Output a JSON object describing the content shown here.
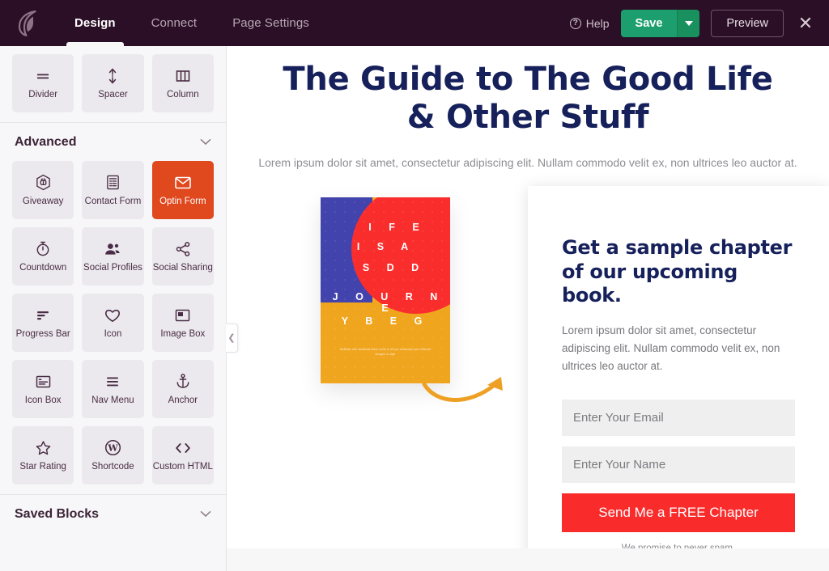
{
  "topbar": {
    "logo_icon": "seedprod-leaf-logo",
    "tabs": [
      {
        "label": "Design",
        "active": true
      },
      {
        "label": "Connect",
        "active": false
      },
      {
        "label": "Page Settings",
        "active": false
      }
    ],
    "help_label": "Help",
    "help_icon": "question-circle-icon",
    "save_label": "Save",
    "save_caret_icon": "chevron-down-icon",
    "preview_label": "Preview",
    "close_icon": "close-icon",
    "colors": {
      "bar_background": "#2b0f26",
      "save_green": "#1c9e6e",
      "active_tab_text": "#ffffff",
      "inactive_tab_text": "#b9a7b4"
    }
  },
  "sidebar": {
    "collapse_icon": "chevron-left-icon",
    "top_blocks": [
      {
        "label": "Divider",
        "icon": "divider-icon"
      },
      {
        "label": "Spacer",
        "icon": "spacer-arrows-icon"
      },
      {
        "label": "Column",
        "icon": "columns-icon"
      }
    ],
    "sections": [
      {
        "title": "Advanced",
        "chevron_icon": "chevron-down-icon",
        "blocks": [
          {
            "label": "Giveaway",
            "icon": "giveaway-icon",
            "selected": false
          },
          {
            "label": "Contact Form",
            "icon": "contact-form-icon",
            "selected": false
          },
          {
            "label": "Optin Form",
            "icon": "envelope-icon",
            "selected": true
          },
          {
            "label": "Countdown",
            "icon": "stopwatch-icon",
            "selected": false
          },
          {
            "label": "Social Profiles",
            "icon": "people-icon",
            "selected": false
          },
          {
            "label": "Social Sharing",
            "icon": "share-nodes-icon",
            "selected": false
          },
          {
            "label": "Progress Bar",
            "icon": "progress-bar-icon",
            "selected": false
          },
          {
            "label": "Icon",
            "icon": "heart-icon",
            "selected": false
          },
          {
            "label": "Image Box",
            "icon": "image-box-icon",
            "selected": false
          },
          {
            "label": "Icon Box",
            "icon": "icon-box-icon",
            "selected": false
          },
          {
            "label": "Nav Menu",
            "icon": "hamburger-icon",
            "selected": false
          },
          {
            "label": "Anchor",
            "icon": "anchor-icon",
            "selected": false
          },
          {
            "label": "Star Rating",
            "icon": "star-icon",
            "selected": false
          },
          {
            "label": "Shortcode",
            "icon": "wordpress-icon",
            "selected": false
          },
          {
            "label": "Custom HTML",
            "icon": "code-brackets-icon",
            "selected": false
          }
        ]
      },
      {
        "title": "Saved Blocks",
        "chevron_icon": "chevron-down-icon",
        "blocks": []
      }
    ],
    "colors": {
      "panel_background": "#f7f7f9",
      "tile_background": "#ebe9ee",
      "tile_selected": "#e0481e",
      "tile_text": "#4a2c44"
    }
  },
  "canvas": {
    "hero": {
      "heading_line1": "The Guide to The Good Life",
      "heading_line2": "& Other Stuff",
      "subtext": "Lorem ipsum dolor sit amet, consectetur adipiscing elit. Nullam commodo velit ex, non ultrices leo auctor at.",
      "heading_color": "#16215b"
    },
    "book_cover": {
      "alt": "book-cover-image",
      "lines": [
        "I F E",
        "I S  A",
        "S D D",
        "J O U R N E",
        "Y B E G"
      ],
      "fine_print": "Realistic and handbook mock cover to let you showcase your editorial designs in style",
      "colors": {
        "blue": "#4243ad",
        "red": "#fa2d2d",
        "yellow": "#f0a51f"
      }
    },
    "arrow": {
      "icon": "curved-arrow-icon",
      "color": "#eda024"
    },
    "optin": {
      "heading": "Get a sample chapter of our upcoming book.",
      "description": "Lorem ipsum dolor sit amet, consectetur adipiscing elit. Nullam commodo velit ex, non ultrices leo auctor at.",
      "email_placeholder": "Enter Your Email",
      "email_value": "",
      "name_placeholder": "Enter Your Name",
      "name_value": "",
      "submit_label": "Send Me a FREE Chapter",
      "disclaimer": "We promise to never spam.",
      "colors": {
        "heading": "#16215b",
        "button": "#f92b2b",
        "field_bg": "#efefef"
      }
    }
  }
}
